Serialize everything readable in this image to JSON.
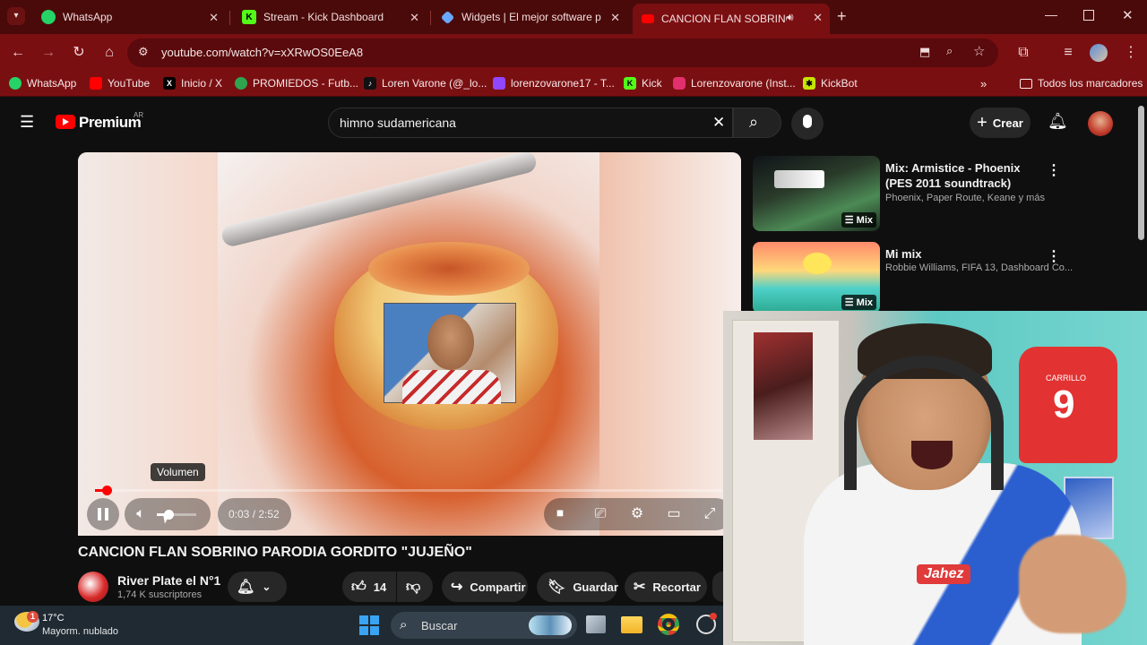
{
  "tabs": [
    {
      "title": "WhatsApp",
      "icon": "whatsapp-icon",
      "color": "#25d366"
    },
    {
      "title": "Stream - Kick Dashboard",
      "icon": "kick-icon",
      "color": "#53fc18"
    },
    {
      "title": "Widgets | El mejor software par",
      "icon": "widgets-icon",
      "color": "#6aa7ff"
    },
    {
      "title": "CANCION FLAN SOBRINO",
      "icon": "youtube-icon",
      "color": "#ff0000"
    }
  ],
  "address": {
    "url": "youtube.com/watch?v=xXRwOS0EeA8"
  },
  "bookmarks": [
    {
      "label": "WhatsApp",
      "color": "#25d366"
    },
    {
      "label": "YouTube",
      "color": "#ff0000"
    },
    {
      "label": "Inicio / X",
      "color": "#000000"
    },
    {
      "label": "PROMIEDOS - Futb...",
      "color": "#2ea44f"
    },
    {
      "label": "Loren Varone (@_lo...",
      "color": "#111111"
    },
    {
      "label": "lorenzovarone17 - T...",
      "color": "#9146ff"
    },
    {
      "label": "Kick",
      "color": "#53fc18"
    },
    {
      "label": "Lorenzovarone (Inst...",
      "color": "#e1306c"
    },
    {
      "label": "KickBot",
      "color": "#c6e400"
    }
  ],
  "bookmarks_all": "Todos los marcadores",
  "masthead": {
    "logo": "Premium",
    "country": "AR",
    "search_value": "himno sudamericana",
    "create_label": "Crear"
  },
  "player": {
    "time": "0:03 / 2:52",
    "progress": 0.018,
    "volume_tooltip": "Volumen",
    "volume_level": 0.3
  },
  "video": {
    "title": "CANCION FLAN SOBRINO PARODIA GORDITO \"JUJEÑO\"",
    "channel": "River Plate el N°1",
    "subscribers": "1,74 K suscriptores",
    "likes": "14",
    "share_label": "Compartir",
    "save_label": "Guardar",
    "clip_label": "Recortar"
  },
  "recommendations": [
    {
      "title": "Mix: Armistice - Phoenix (PES 2011 soundtrack)",
      "subtitle": "Phoenix, Paper Route, Keane y más",
      "badge": "Mix"
    },
    {
      "title": "Mi mix",
      "subtitle": "Robbie Williams, FIFA 13, Dashboard Co...",
      "badge": "Mix"
    }
  ],
  "webcam": {
    "jersey_name": "CARRILLO",
    "jersey_number": "9",
    "sponsor": "Jahez"
  },
  "taskbar": {
    "temperature": "17°C",
    "weather": "Mayorm. nublado",
    "weather_badge": "1",
    "search_label": "Buscar"
  }
}
